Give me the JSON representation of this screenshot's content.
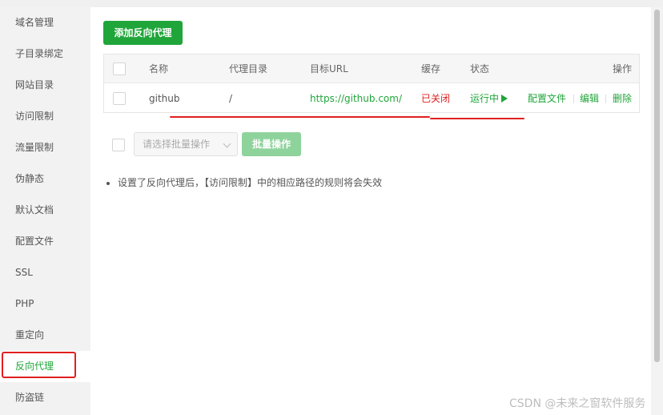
{
  "sidebar": {
    "items": [
      {
        "label": "域名管理"
      },
      {
        "label": "子目录绑定"
      },
      {
        "label": "网站目录"
      },
      {
        "label": "访问限制"
      },
      {
        "label": "流量限制"
      },
      {
        "label": "伪静态"
      },
      {
        "label": "默认文档"
      },
      {
        "label": "配置文件"
      },
      {
        "label": "SSL"
      },
      {
        "label": "PHP"
      },
      {
        "label": "重定向"
      },
      {
        "label": "反向代理"
      },
      {
        "label": "防盗链"
      }
    ],
    "active_item": "反向代理"
  },
  "toolbar": {
    "add_label": "添加反向代理"
  },
  "table": {
    "headers": {
      "name": "名称",
      "proxy_dir": "代理目录",
      "target_url": "目标URL",
      "cache": "缓存",
      "status": "状态",
      "actions": "操作"
    },
    "rows": [
      {
        "name": "github",
        "proxy_dir": "/",
        "target_url": "https://github.com/",
        "cache": "已关闭",
        "status": "运行中",
        "actions": [
          "配置文件",
          "编辑",
          "删除"
        ]
      }
    ]
  },
  "batch": {
    "select_placeholder": "请选择批量操作",
    "button_label": "批量操作"
  },
  "note": "设置了反向代理后，【访问限制】中的相应路径的规则将会失效",
  "watermark": "CSDN @未来之窗软件服务",
  "colors": {
    "accent": "#20a53a",
    "danger": "#e02020"
  }
}
